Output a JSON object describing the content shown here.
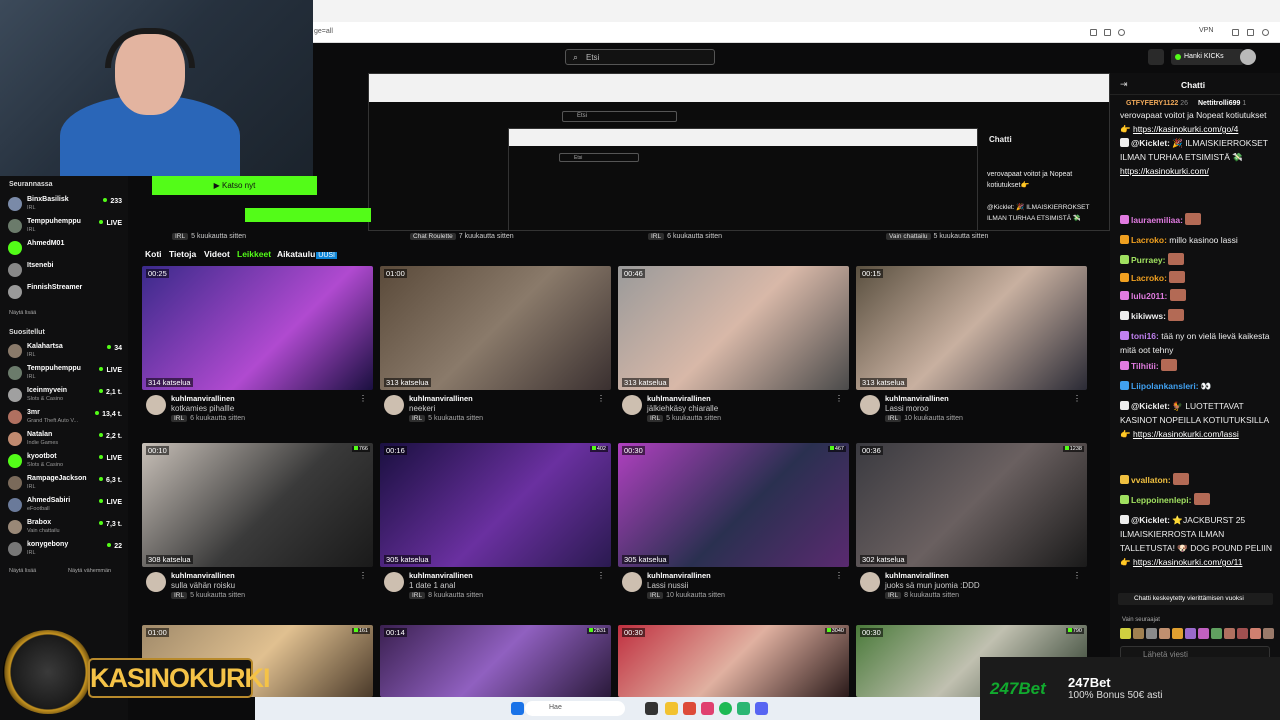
{
  "browser": {
    "address": "ge=all",
    "vpn_label": "VPN"
  },
  "topnav": {
    "search_placeholder": "Etsi",
    "kicks_button": "Hanki KICKs"
  },
  "stream_overlay": {
    "watch_button": "Katso nyt"
  },
  "sidebar": {
    "following_heading": "Seurannassa",
    "following": [
      {
        "name": "BinxBasilisk",
        "category": "IRL",
        "viewers": "233",
        "color": "#7a8aa8"
      },
      {
        "name": "Temppuhemppu",
        "category": "IRL",
        "viewers": "LIVE",
        "color": "#6b7b6b"
      },
      {
        "name": "AhmedM01",
        "category": "",
        "viewers": "",
        "color": "#53fc18"
      },
      {
        "name": "Itsenebi",
        "category": "",
        "viewers": "",
        "color": "#888888"
      },
      {
        "name": "FinnishStreamer",
        "category": "",
        "viewers": "",
        "color": "#999999"
      }
    ],
    "show_more_following": "Näytä lisää",
    "recommended_heading": "Suositellut",
    "recommended": [
      {
        "name": "Kalahartsa",
        "category": "IRL",
        "viewers": "34",
        "color": "#8a7a6a"
      },
      {
        "name": "Temppuhemppu",
        "category": "IRL",
        "viewers": "LIVE",
        "color": "#6b7b6b"
      },
      {
        "name": "Iceinmyvein",
        "category": "Slots & Casino",
        "viewers": "2,1 t.",
        "color": "#a0a0a0"
      },
      {
        "name": "3mr",
        "category": "Grand Theft Auto V...",
        "viewers": "13,4 t.",
        "color": "#b07060"
      },
      {
        "name": "Natalan",
        "category": "Indie Games",
        "viewers": "2,2 t.",
        "color": "#c08a70"
      },
      {
        "name": "kyootbot",
        "category": "Slots & Casino",
        "viewers": "LIVE",
        "color": "#53fc18"
      },
      {
        "name": "RampageJackson",
        "category": "IRL",
        "viewers": "6,3 t.",
        "color": "#7a6a5a"
      },
      {
        "name": "AhmedSabiri",
        "category": "eFootball",
        "viewers": "LIVE",
        "color": "#6a7a9a"
      },
      {
        "name": "Brabox",
        "category": "Vain chattailu",
        "viewers": "7,3 t.",
        "color": "#998877"
      },
      {
        "name": "konygebony",
        "category": "IRL",
        "viewers": "22",
        "color": "#777777"
      }
    ],
    "show_more": "Näytä lisää",
    "show_less": "Näytä vähemmän"
  },
  "row_labels": [
    {
      "tag": "IRL",
      "time": "5 kuukautta sitten"
    },
    {
      "tag": "Chat Roulette",
      "time": "7 kuukautta sitten"
    },
    {
      "tag": "IRL",
      "time": "6 kuukautta sitten"
    },
    {
      "tag": "Vain chattailu",
      "time": "5 kuukautta sitten"
    }
  ],
  "tabs": {
    "home": "Koti",
    "about": "Tietoja",
    "videos": "Videot",
    "clips": "Leikkeet",
    "schedule": "Aikataulu",
    "new_badge": "UUSI"
  },
  "clips": [
    {
      "duration": "00:25",
      "views": "314 katselua",
      "likes": "",
      "channel": "kuhlmanvirallinen",
      "title": "kotkamies pihallle",
      "tag": "IRL",
      "age": "6 kuukautta sitten",
      "bg": "linear-gradient(135deg,#3a2a8a,#b04ad0 60%,#1a1040)"
    },
    {
      "duration": "01:00",
      "views": "313 katselua",
      "likes": "",
      "channel": "kuhlmanvirallinen",
      "title": "neekeri",
      "tag": "IRL",
      "age": "5 kuukautta sitten",
      "bg": "linear-gradient(135deg,#5a4a3a,#8a7a6a 50%,#3a3030)"
    },
    {
      "duration": "00:46",
      "views": "313 katselua",
      "likes": "",
      "channel": "kuhlmanvirallinen",
      "title": "jälkiehkäsy chiaralle",
      "tag": "IRL",
      "age": "5 kuukautta sitten",
      "bg": "linear-gradient(135deg,#9a9a9a,#d8b8a8 50%,#4a4a4a)"
    },
    {
      "duration": "00:15",
      "views": "313 katselua",
      "likes": "",
      "channel": "kuhlmanvirallinen",
      "title": "Lassi moroo",
      "tag": "IRL",
      "age": "10 kuukautta sitten",
      "bg": "linear-gradient(135deg,#5a5040,#c8b0a0 50%,#2a2a35)"
    },
    {
      "duration": "00:10",
      "views": "308 katselua",
      "likes": "766",
      "channel": "kuhlmanvirallinen",
      "title": "sulla vähän roisku",
      "tag": "IRL",
      "age": "5 kuukautta sitten",
      "bg": "linear-gradient(135deg,#c8c0b8,#3a3a3a 55%,#1a1a1a)"
    },
    {
      "duration": "00:16",
      "views": "305 katselua",
      "likes": "402",
      "channel": "kuhlmanvirallinen",
      "title": "1 date 1 anal",
      "tag": "IRL",
      "age": "8 kuukautta sitten",
      "bg": "linear-gradient(135deg,#1a1040,#6a30a0 55%,#2a1a50)"
    },
    {
      "duration": "00:30",
      "views": "305 katselua",
      "likes": "467",
      "channel": "kuhlmanvirallinen",
      "title": "Lassi nussii",
      "tag": "IRL",
      "age": "10 kuukautta sitten",
      "bg": "linear-gradient(135deg,#b040c0,#2a3050 55%,#5a2a70)"
    },
    {
      "duration": "00:36",
      "views": "302 katselua",
      "likes": "1238",
      "channel": "kuhlmanvirallinen",
      "title": "juoks sä mun juomia :DDD",
      "tag": "IRL",
      "age": "8 kuukautta sitten",
      "bg": "linear-gradient(135deg,#3a3a40,#6a6060 50%,#1a1a1a)"
    },
    {
      "duration": "01:00",
      "views": "",
      "likes": "161",
      "channel": "",
      "title": "",
      "tag": "",
      "age": "",
      "bg": "linear-gradient(135deg,#a08a6a,#e0c090 50%,#4a3a2a)"
    },
    {
      "duration": "00:14",
      "views": "",
      "likes": "2831",
      "channel": "",
      "title": "",
      "tag": "",
      "age": "",
      "bg": "linear-gradient(135deg,#3a2050,#9060c0 50%,#2a1a3a)"
    },
    {
      "duration": "00:30",
      "views": "",
      "likes": "3040",
      "channel": "",
      "title": "",
      "tag": "",
      "age": "",
      "bg": "linear-gradient(135deg,#c03040,#e0b0a0 50%,#2a1a1a)"
    },
    {
      "duration": "00:30",
      "views": "",
      "likes": "790",
      "channel": "",
      "title": "",
      "tag": "",
      "age": "",
      "bg": "linear-gradient(135deg,#4a7a3a,#c0c0b0 50%,#2a3a2a)"
    }
  ],
  "chat": {
    "title": "Chatti",
    "pinned_users": [
      "GTFYFERY1122",
      "26",
      "Nettitrolli699",
      "1"
    ],
    "messages": [
      {
        "user": "",
        "text": "verovapaat voitot ja Nopeat kotiutukset👉",
        "link": "https://kasinokurki.com/go/4",
        "color": "#eeeeee"
      },
      {
        "user": "@Kicklet:",
        "text": "🎉 ILMAISKIERROKSET ILMAN TURHAA ETSIMISTÄ 💸",
        "link": "https://kasinokurki.com/",
        "color": "#eeeeee"
      },
      {
        "user": "lauraemiliaa:",
        "text": "",
        "link": "",
        "color": "#e07be0"
      },
      {
        "user": "Lacroko:",
        "text": "millo kasinoo lassi",
        "link": "",
        "color": "#f0a020"
      },
      {
        "user": "Purraey:",
        "text": "",
        "link": "",
        "color": "#a0e060"
      },
      {
        "user": "Lacroko:",
        "text": "",
        "link": "",
        "color": "#f0a020"
      },
      {
        "user": "lulu2011:",
        "text": "",
        "link": "",
        "color": "#e07be0"
      },
      {
        "user": "kikiwws:",
        "text": "",
        "link": "",
        "color": "#eeeeee"
      },
      {
        "user": "toni16:",
        "text": "tää ny on vielä lievä kaikesta mitä oot tehny",
        "link": "",
        "color": "#c080f0"
      },
      {
        "user": "Tilhitii:",
        "text": "",
        "link": "",
        "color": "#e07be0"
      },
      {
        "user": "Liipolankansleri:",
        "text": "👀",
        "link": "",
        "color": "#40a0f0"
      },
      {
        "user": "@Kicklet:",
        "text": "🐓 LUOTETTAVAT KASINOT NOPEILLA KOTIUTUKSILLA👉",
        "link": "https://kasinokurki.com/lassi",
        "color": "#eeeeee"
      },
      {
        "user": "vvallaton:",
        "text": "",
        "link": "",
        "color": "#f0c040"
      },
      {
        "user": "Leppoinenlepi:",
        "text": "",
        "link": "",
        "color": "#a0e060"
      },
      {
        "user": "@Kicklet:",
        "text": "⭐JACKBURST 25 ILMAISKIERROSTA ILMAN TALLETUSTA! 🐶 DOG POUND PELIIN👉",
        "link": "https://kasinokurki.com/go/11",
        "color": "#eeeeee"
      }
    ],
    "scroll_paused": "Chatti keskeytetty vierittämisen vuoksi",
    "subs_only": "Vain seuraajat",
    "input_placeholder": "Lähetä viesti"
  },
  "logo": {
    "text": "KASINOKURKI"
  },
  "taskbar": {
    "search": "Hae"
  },
  "ad": {
    "brand": "247Bet",
    "title": "247Bet",
    "subtitle": "100% Bonus 50€ asti"
  },
  "recursion": {
    "search": "Etsi",
    "chat_title": "Chatti",
    "kicks": "Hanki KICKs",
    "chat_line1": "verovapaat voitot ja Nopeat kotiutukset👉",
    "chat_link1": "https://kasinokurki.com/go/4",
    "chat_line2": "@Kicklet: 🎉 ILMAISKIERROKSET ILMAN TURHAA ETSIMISTÄ 💸",
    "chat_link2": "https://kasinokurki.com/"
  }
}
